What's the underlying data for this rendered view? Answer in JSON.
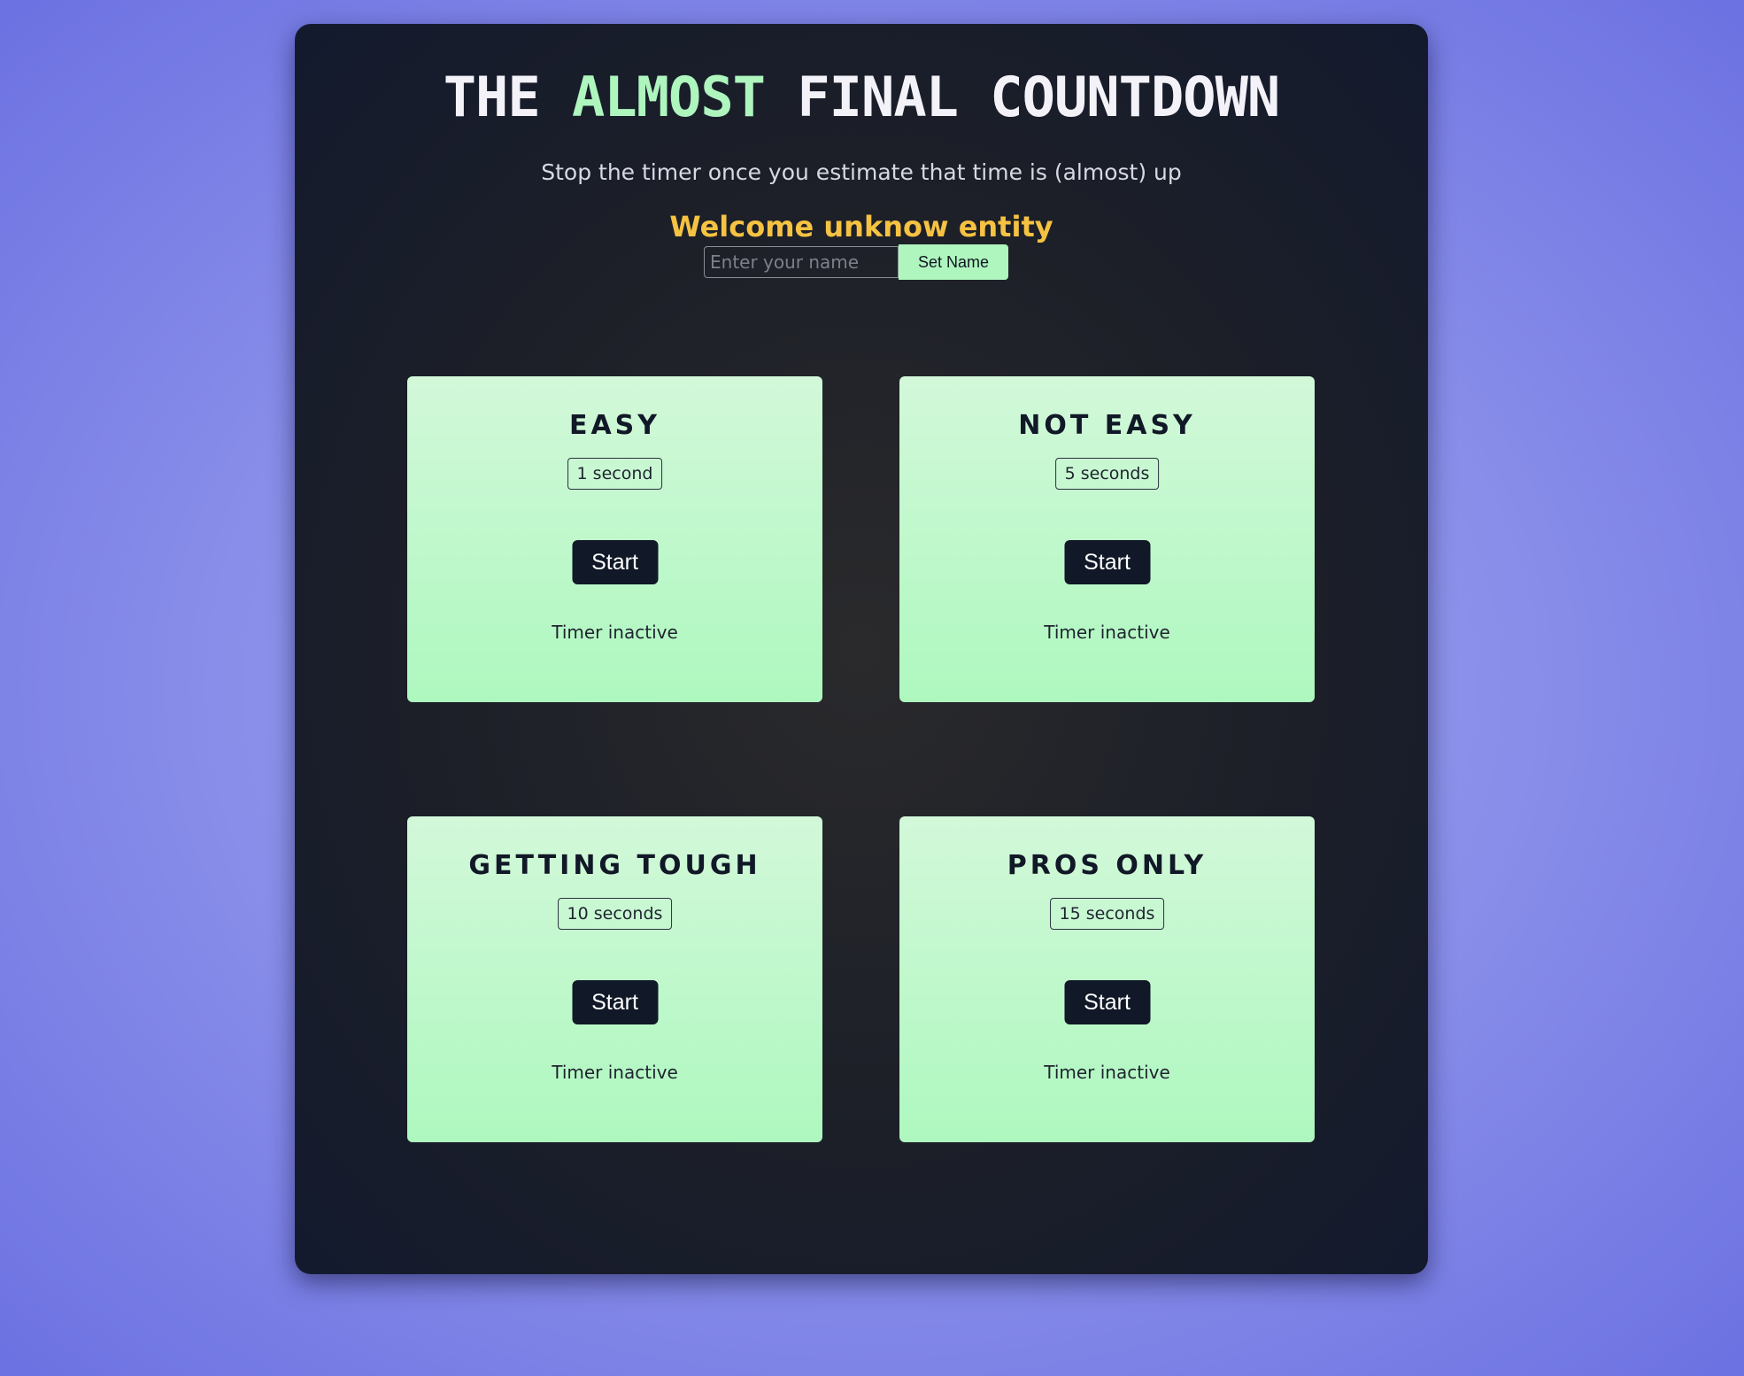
{
  "header": {
    "title_part1": "THE ",
    "title_accent": "ALMOST",
    "title_part2": " FINAL COUNTDOWN",
    "subtitle": "Stop the timer once you estimate that time is (almost) up",
    "welcome": "Welcome unknow entity"
  },
  "name_form": {
    "placeholder": "Enter your name",
    "value": "",
    "button_label": "Set Name"
  },
  "levels": [
    {
      "title": "EASY",
      "duration": "1 second",
      "button_label": "Start",
      "status": "Timer inactive"
    },
    {
      "title": "NOT EASY",
      "duration": "5 seconds",
      "button_label": "Start",
      "status": "Timer inactive"
    },
    {
      "title": "GETTING TOUGH",
      "duration": "10 seconds",
      "button_label": "Start",
      "status": "Timer inactive"
    },
    {
      "title": "PROS ONLY",
      "duration": "15 seconds",
      "button_label": "Start",
      "status": "Timer inactive"
    }
  ],
  "colors": {
    "accent_green": "#aef5be",
    "welcome_yellow": "#f5c242",
    "card_dark": "#111827",
    "background_purple": "#8d93ea"
  }
}
